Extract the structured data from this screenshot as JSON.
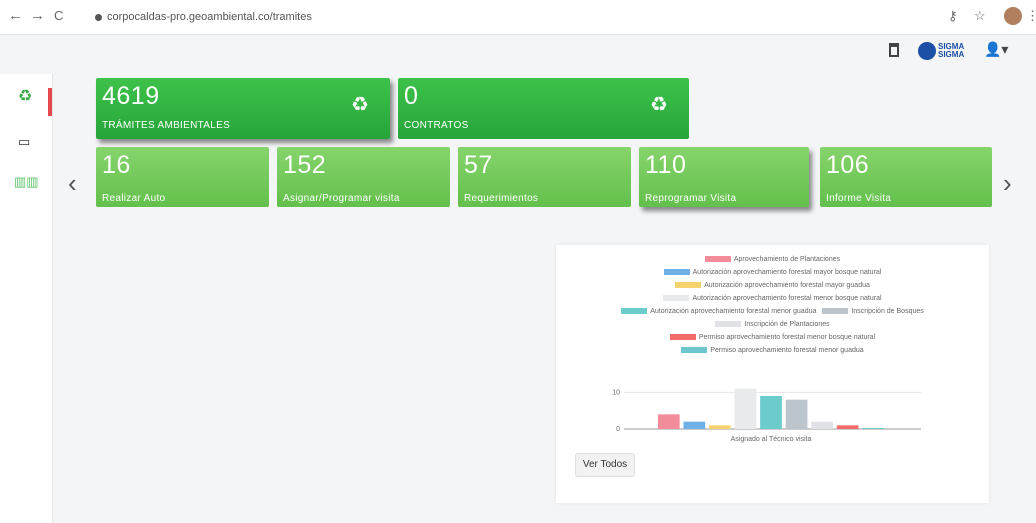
{
  "browser": {
    "url": "corpocaldas-pro.geoambiental.co/tramites",
    "back_icon": "back-arrow-icon",
    "forward_icon": "forward-arrow-icon",
    "reload_icon": "reload-icon"
  },
  "header": {
    "brand_text_1": "SIGMA",
    "brand_text_2": "SIGMA"
  },
  "summary_cards": [
    {
      "value": "4619",
      "label": "TRÁMITES AMBIENTALES"
    },
    {
      "value": "0",
      "label": "CONTRATOS"
    }
  ],
  "status_cards": [
    {
      "value": "16",
      "label": "Realizar Auto"
    },
    {
      "value": "152",
      "label": "Asignar/Programar visita"
    },
    {
      "value": "57",
      "label": "Requerimientos"
    },
    {
      "value": "110",
      "label": "Reprogramar Visita"
    },
    {
      "value": "106",
      "label": "Informe Visita"
    }
  ],
  "chart_button": "Ver Todos",
  "colors": {
    "accent_green": "#3ec24a",
    "light_green": "#86d46c",
    "active_red": "#e5484d"
  },
  "chart_data": {
    "type": "bar",
    "categories": [
      "Asignado al Técnico visita"
    ],
    "xlabel": "Asignado al Técnico visita",
    "yticks": [
      0,
      10
    ],
    "ylim": [
      0,
      12
    ],
    "series": [
      {
        "name": "Aprovechamiento de Plantaciones",
        "values": [
          4
        ],
        "color": "#f28b9a"
      },
      {
        "name": "Autorización aprovechamiento forestal mayor bosque natural",
        "values": [
          2
        ],
        "color": "#6fb0e8"
      },
      {
        "name": "Autorización aprovechamiento forestal mayor guadua",
        "values": [
          1
        ],
        "color": "#f6d36f"
      },
      {
        "name": "Autorización aprovechamiento forestal menor bosque natural",
        "values": [
          11
        ],
        "color": "#e8eaec"
      },
      {
        "name": "Autorización aprovechamiento forestal menor guadua",
        "values": [
          9
        ],
        "color": "#6ccccc"
      },
      {
        "name": "Inscripción de Bosques",
        "values": [
          8
        ],
        "color": "#bcc5cc"
      },
      {
        "name": "Inscripción de Plantaciones",
        "values": [
          2
        ],
        "color": "#e0e2e5"
      },
      {
        "name": "Permiso aprovechamiento forestal menor bosque natural",
        "values": [
          1
        ],
        "color": "#f26b6b"
      },
      {
        "name": "Permiso aprovechamiento forestal menor guadua",
        "values": [
          0.3
        ],
        "color": "#6cc7cf"
      }
    ],
    "legend_position": "top",
    "grid": true
  }
}
